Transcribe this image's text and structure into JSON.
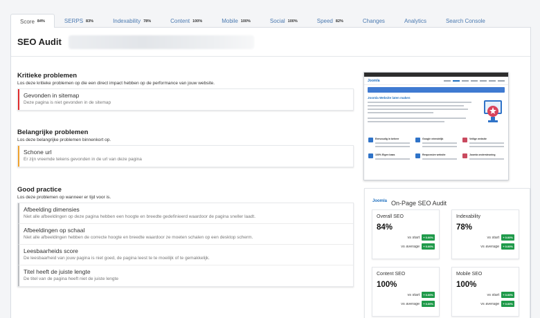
{
  "tabs": [
    {
      "label": "Score",
      "pct": "84%"
    },
    {
      "label": "SERPS",
      "pct": "83%"
    },
    {
      "label": "Indexability",
      "pct": "78%"
    },
    {
      "label": "Content",
      "pct": "100%"
    },
    {
      "label": "Mobile",
      "pct": "100%"
    },
    {
      "label": "Social",
      "pct": "100%"
    },
    {
      "label": "Speed",
      "pct": "82%"
    },
    {
      "label": "Changes",
      "pct": ""
    },
    {
      "label": "Analytics",
      "pct": ""
    },
    {
      "label": "Search Console",
      "pct": ""
    }
  ],
  "header": {
    "title": "SEO Audit"
  },
  "sections": {
    "critical": {
      "title": "Kritieke problemen",
      "subtitle": "Los deze kritieke problemen op die een direct impact hebben op de performance van jouw website.",
      "items": [
        {
          "title": "Gevonden in sitemap",
          "desc": "Deze pagina is niet gevonden in de sitemap"
        }
      ]
    },
    "important": {
      "title": "Belangrijke problemen",
      "subtitle": "Los deze belangrijke problemen binnenkort op.",
      "items": [
        {
          "title": "Schone url",
          "desc": "Er zijn vreemde tekens gevonden in de url van deze pagina"
        }
      ]
    },
    "good": {
      "title": "Good practice",
      "subtitle": "Los deze problemen op wanneer er tijd voor is.",
      "items": [
        {
          "title": "Afbeelding dimensies",
          "desc": "Niet alle afbeeldingen op deze pagina hebben een hoogte en breedte gedefinieerd waardoor de pagina sneller laadt."
        },
        {
          "title": "Afbeeldingen op schaal",
          "desc": "Niet alle afbeeldingen hebben de correcte hoogte en breedte waardoor ze moeten schalen op een desktop scherm."
        },
        {
          "title": "Leesbaarheids score",
          "desc": "De leesbaarheid van jouw pagina is niet goed, de pagina leest te te moeilijk of te gemakkelijk."
        },
        {
          "title": "Titel heeft de juiste lengte",
          "desc": "De titel van de pagina heeft niet de juiste lengte"
        }
      ]
    }
  },
  "preview": {
    "logo": "Joomla",
    "hero_title": "Joomla Website laten maken",
    "features": [
      "Eenvoudig in beheer",
      "Google vriendelijk",
      "Veilige website",
      "100% Eigen baas",
      "Responsive website",
      "Joomla ondersteuning"
    ]
  },
  "summary": {
    "logo": "Joomla",
    "title": "On-Page SEO Audit",
    "vs_start_label": "vs start",
    "vs_average_label": "vs average",
    "cards": [
      {
        "label": "Overall SEO",
        "value": "84%",
        "vs_start": "+ 0.00%",
        "vs_average": "+ 0.00%"
      },
      {
        "label": "Indexability",
        "value": "78%",
        "vs_start": "+ 0.00%",
        "vs_average": "+ 0.00%"
      },
      {
        "label": "Content SEO",
        "value": "100%",
        "vs_start": "+ 0.00%",
        "vs_average": "+ 0.00%"
      },
      {
        "label": "Mobile SEO",
        "value": "100%",
        "vs_start": "+ 0.00%",
        "vs_average": "+ 0.00%"
      }
    ]
  },
  "colors": {
    "critical": "#e02c2c",
    "important": "#f0a22e",
    "good": "#b9bcc0",
    "badge": "#1f9a4a",
    "link": "#4a79b0"
  }
}
